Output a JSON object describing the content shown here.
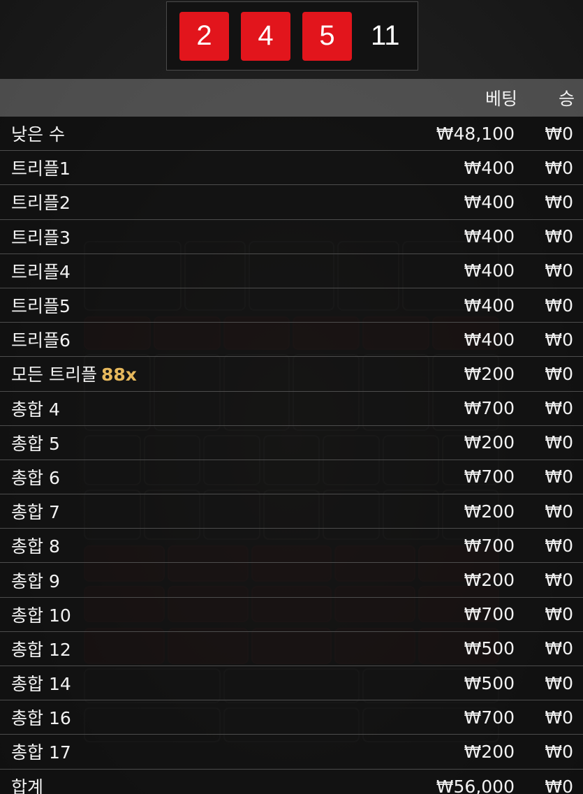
{
  "result": {
    "dice": [
      "2",
      "4",
      "5"
    ],
    "sum": "11"
  },
  "table": {
    "header": {
      "bet": "베팅",
      "win": "승"
    },
    "rows": [
      {
        "label": "낮은 수",
        "bet": "₩48,100",
        "win": "₩0"
      },
      {
        "label": "트리플1",
        "bet": "₩400",
        "win": "₩0"
      },
      {
        "label": "트리플2",
        "bet": "₩400",
        "win": "₩0"
      },
      {
        "label": "트리플3",
        "bet": "₩400",
        "win": "₩0"
      },
      {
        "label": "트리플4",
        "bet": "₩400",
        "win": "₩0"
      },
      {
        "label": "트리플5",
        "bet": "₩400",
        "win": "₩0"
      },
      {
        "label": "트리플6",
        "bet": "₩400",
        "win": "₩0"
      },
      {
        "label": "모든 트리플",
        "multiplier": "88x",
        "bet": "₩200",
        "win": "₩0"
      },
      {
        "label": "총합 4",
        "bet": "₩700",
        "win": "₩0"
      },
      {
        "label": "총합 5",
        "bet": "₩200",
        "win": "₩0"
      },
      {
        "label": "총합 6",
        "bet": "₩700",
        "win": "₩0"
      },
      {
        "label": "총합 7",
        "bet": "₩200",
        "win": "₩0"
      },
      {
        "label": "총합 8",
        "bet": "₩700",
        "win": "₩0"
      },
      {
        "label": "총합 9",
        "bet": "₩200",
        "win": "₩0"
      },
      {
        "label": "총합 10",
        "bet": "₩700",
        "win": "₩0"
      },
      {
        "label": "총합 12",
        "bet": "₩500",
        "win": "₩0"
      },
      {
        "label": "총합 14",
        "bet": "₩500",
        "win": "₩0"
      },
      {
        "label": "총합 16",
        "bet": "₩700",
        "win": "₩0"
      },
      {
        "label": "총합 17",
        "bet": "₩200",
        "win": "₩0"
      }
    ],
    "total": {
      "label": "합계",
      "bet": "₩56,000",
      "win": "₩0"
    }
  },
  "colors": {
    "die": "#e2151c",
    "multiplier": "#e6b85c",
    "header_bg": "#6e6e6e"
  }
}
